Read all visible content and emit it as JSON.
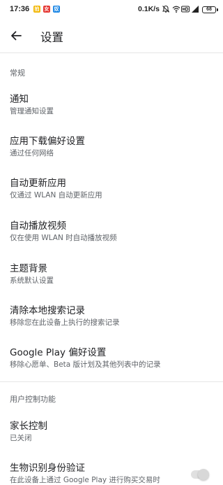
{
  "status_bar": {
    "time": "17:36",
    "notifications": [
      "拍",
      "女",
      "奴"
    ],
    "network_speed": "0.1K/s",
    "battery": "68",
    "icons": [
      "bell-off-icon",
      "wifi-icon",
      "hd-icon",
      "signal-icon",
      "battery-icon"
    ]
  },
  "app_bar": {
    "back_icon": "arrow-left-icon",
    "title": "设置"
  },
  "sections": [
    {
      "header": "常规",
      "items": [
        {
          "title": "通知",
          "subtitle": "管理通知设置"
        },
        {
          "title": "应用下载偏好设置",
          "subtitle": "通过任何网络"
        },
        {
          "title": "自动更新应用",
          "subtitle": "仅通过 WLAN 自动更新应用"
        },
        {
          "title": "自动播放视频",
          "subtitle": "仅在使用 WLAN 时自动播放视频"
        },
        {
          "title": "主题背景",
          "subtitle": "系统默认设置"
        },
        {
          "title": "清除本地搜索记录",
          "subtitle": "移除您在此设备上执行的搜索记录"
        },
        {
          "title": "Google Play 偏好设置",
          "subtitle": "移除心愿单、Beta 版计划及其他列表中的记录"
        }
      ]
    },
    {
      "header": "用户控制功能",
      "items": [
        {
          "title": "家长控制",
          "subtitle": "已关闭"
        },
        {
          "title": "生物识别身份验证",
          "subtitle": "在此设备上通过 Google Play 进行购买交易时",
          "toggle": false
        }
      ]
    }
  ],
  "colors": {
    "text_primary": "#202124",
    "text_secondary": "#5f6368",
    "divider": "#e6e6e6"
  }
}
